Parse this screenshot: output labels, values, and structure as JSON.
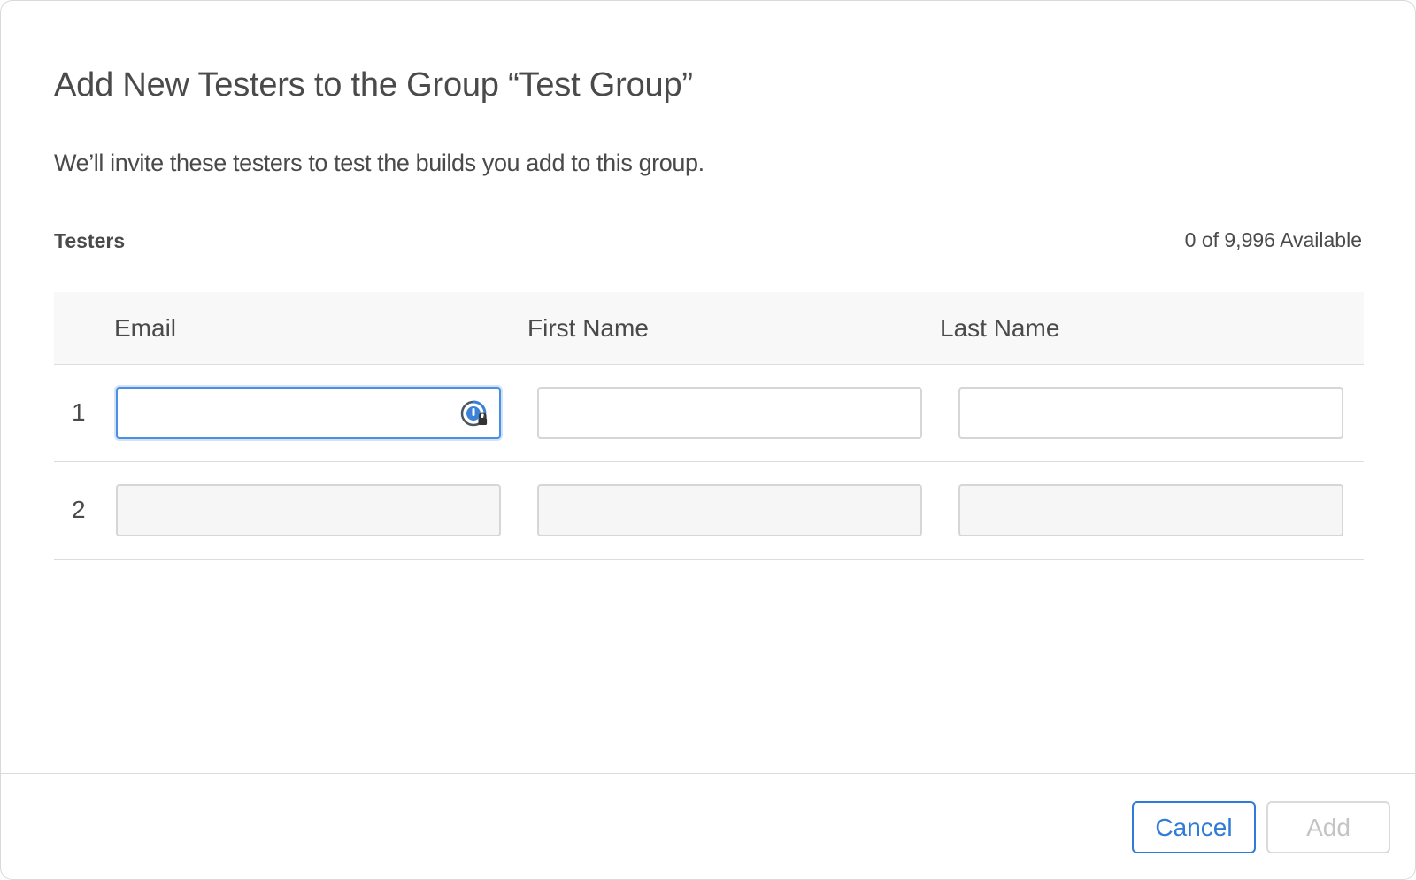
{
  "dialog": {
    "title": "Add New Testers to the Group “Test Group”",
    "subtitle": "We’ll invite these testers to test the builds you add to this group.",
    "section_label": "Testers",
    "available": "0 of 9,996 Available"
  },
  "table": {
    "headers": [
      "Email",
      "First Name",
      "Last Name"
    ],
    "rows": [
      {
        "number": "1",
        "email": "",
        "first_name": "",
        "last_name": "",
        "state": "active"
      },
      {
        "number": "2",
        "email": "",
        "first_name": "",
        "last_name": "",
        "state": "disabled"
      }
    ]
  },
  "icons": {
    "password_manager": "password-manager-icon"
  },
  "footer": {
    "cancel_label": "Cancel",
    "add_label": "Add"
  },
  "colors": {
    "accent": "#2f7bd8",
    "focus": "#4a90e2",
    "disabled_text": "#c4c4c4"
  }
}
